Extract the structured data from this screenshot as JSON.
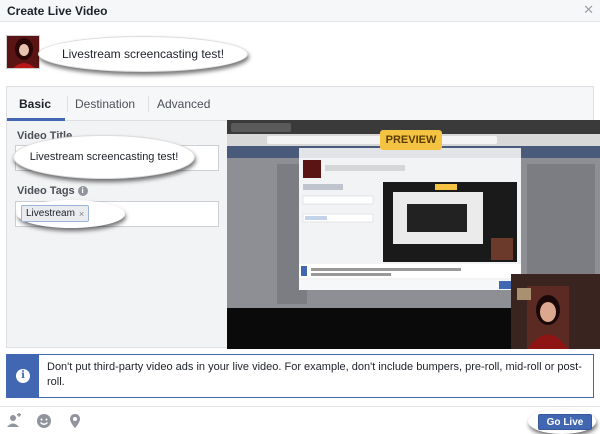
{
  "dialog": {
    "title": "Create Live Video",
    "close_icon": "close-icon"
  },
  "post": {
    "status_text": "Livestream screencasting test!"
  },
  "tabs": [
    {
      "label": "Basic",
      "active": true
    },
    {
      "label": "Destination",
      "active": false
    },
    {
      "label": "Advanced",
      "active": false
    }
  ],
  "form": {
    "video_title_label": "Video Title",
    "video_title_value": "Livestream screencasting test!",
    "video_tags_label": "Video Tags",
    "tags": [
      "Livestream"
    ],
    "tag_remove": "×"
  },
  "preview": {
    "badge": "PREVIEW"
  },
  "notice": {
    "icon": "info-icon",
    "text": "Don't put third-party video ads in your live video. For example, don't include bumpers, pre-roll, mid-roll or post-roll."
  },
  "footer": {
    "icons": [
      "tag-people-icon",
      "feeling-icon",
      "location-icon"
    ],
    "go_live_label": "Go Live"
  },
  "colors": {
    "accent": "#4267b2",
    "preview_badge": "#f5c342",
    "preview_bg": "#0d0d0d"
  }
}
